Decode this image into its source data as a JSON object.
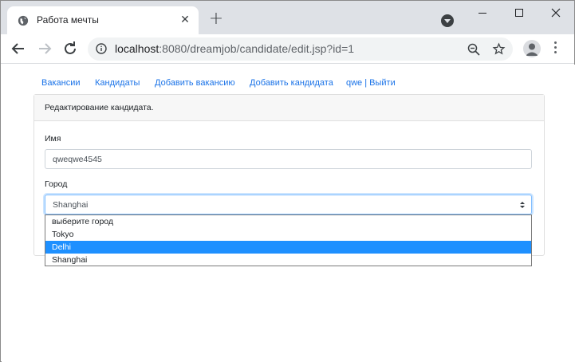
{
  "browser": {
    "tab_title": "Работа мечты",
    "new_tab_label": "+",
    "url_host": "localhost",
    "url_rest": ":8080/dreamjob/candidate/edit.jsp?id=1"
  },
  "nav": {
    "links": [
      "Вакансии",
      "Кандидаты",
      "Добавить вакансию",
      "Добавить кандидата",
      "qwe | Выйти"
    ]
  },
  "card": {
    "header": "Редактирование кандидата."
  },
  "form": {
    "name_label": "Имя",
    "name_value": "qweqwe4545",
    "city_label": "Город",
    "city_selected": "Shanghai",
    "city_options": [
      "выберите город",
      "Tokyo",
      "Delhi",
      "Shanghai"
    ],
    "highlighted_option": "Delhi"
  },
  "colors": {
    "link": "#1a73e8",
    "highlight": "#1e90ff",
    "tabbar": "#dee1e6"
  }
}
